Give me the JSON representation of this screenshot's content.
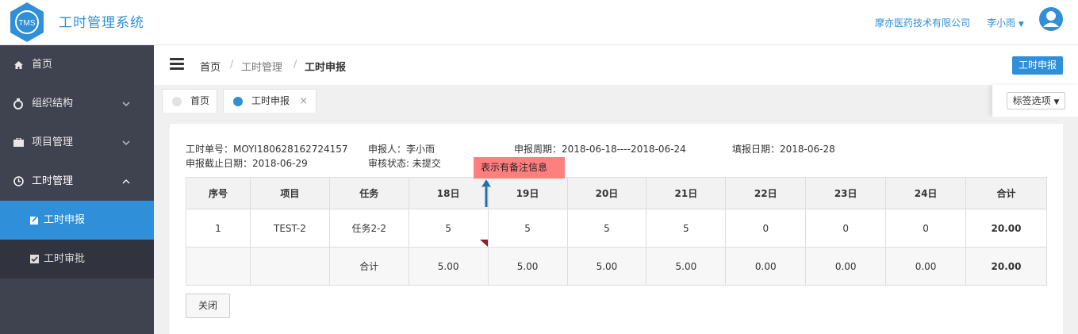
{
  "header": {
    "logo_text": "TMS",
    "app_title": "工时管理系统",
    "company": "摩亦医药技术有限公司",
    "username": "李小雨",
    "colors": {
      "brand": "#2f8fd8",
      "sidebar": "#3f4350"
    }
  },
  "sidebar": {
    "items": [
      {
        "label": "首页",
        "icon": "home-icon"
      },
      {
        "label": "组织结构",
        "icon": "org-icon"
      },
      {
        "label": "项目管理",
        "icon": "briefcase-icon"
      },
      {
        "label": "工时管理",
        "icon": "clock-icon"
      },
      {
        "label": "工时申报",
        "icon": "edit-icon",
        "active": true
      },
      {
        "label": "工时审批",
        "icon": "check-icon"
      }
    ]
  },
  "breadcrumb": {
    "items": [
      "首页",
      "工时管理",
      "工时申报"
    ],
    "separator": "/"
  },
  "report_button": "工时申报",
  "tabs": [
    {
      "label": "首页",
      "active": false
    },
    {
      "label": "工时申报",
      "active": true,
      "close": "×"
    }
  ],
  "tab_options": "标签选项",
  "form": {
    "order_no": "工时单号：MOYI180628162724157",
    "reporter": "申报人：李小雨",
    "period": "申报周期：2018-06-18----2018-06-24",
    "fill_date": "填报日期：2018-06-28",
    "deadline": "申报截止日期：2018-06-29",
    "status": "审核状态: 未提交"
  },
  "table": {
    "headers": [
      "序号",
      "项目",
      "任务",
      "18日",
      "19日",
      "20日",
      "21日",
      "22日",
      "23日",
      "24日",
      "合计"
    ],
    "row": [
      "1",
      "TEST-2",
      "任务2-2",
      "5",
      "5",
      "5",
      "5",
      "0",
      "0",
      "0",
      "20.00"
    ],
    "sum": [
      "",
      "",
      "合计",
      "5.00",
      "5.00",
      "5.00",
      "5.00",
      "0.00",
      "0.00",
      "0.00",
      "20.00"
    ]
  },
  "tooltip": "表示有备注信息",
  "close_button": "关闭"
}
